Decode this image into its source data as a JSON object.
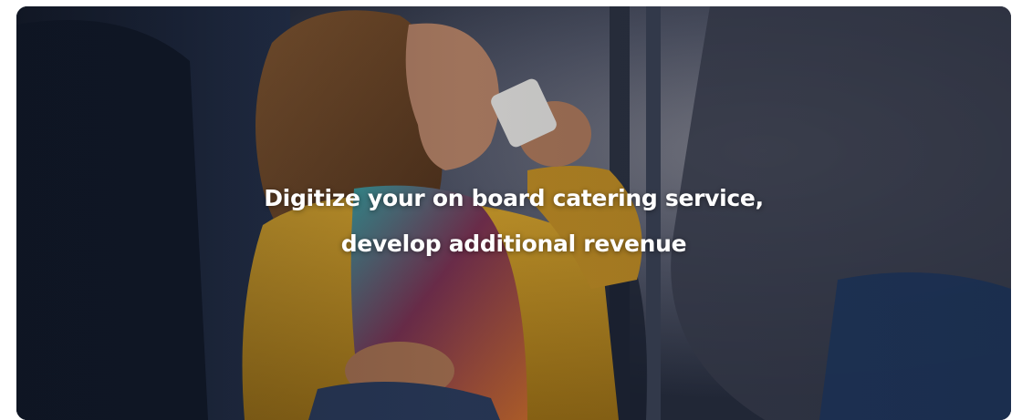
{
  "hero": {
    "heading_line1": "Digitize your on board catering service,",
    "heading_line2": "develop additional revenue",
    "image_subject": "woman-drinking-coffee-on-train-photo"
  },
  "colors": {
    "heading_text": "#ffffff",
    "sweater": "#c9961e",
    "scene_dark": "#1c2433"
  }
}
